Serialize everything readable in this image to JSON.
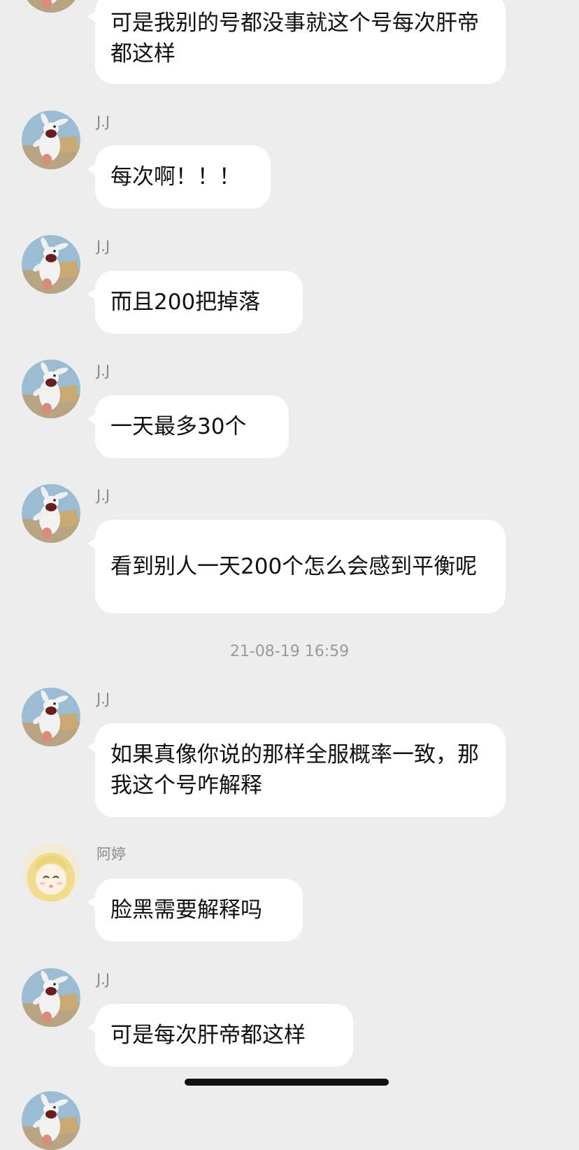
{
  "chat": {
    "timestamp": "21-08-19 16:59",
    "messages": [
      {
        "sender": "",
        "text": "可是我别的号都没事就这个号每次肝帝都这样",
        "avatar": "rabbit-avatar"
      },
      {
        "sender": "J.J",
        "text": "每次啊！！！",
        "avatar": "rabbit-avatar"
      },
      {
        "sender": "J.J",
        "text": "而且200把掉落",
        "avatar": "rabbit-avatar"
      },
      {
        "sender": "J.J",
        "text": "一天最多30个",
        "avatar": "rabbit-avatar"
      },
      {
        "sender": "J.J",
        "text": "看到别人一天200个怎么会感到平衡呢",
        "avatar": "rabbit-avatar"
      },
      {
        "sender": "J.J",
        "text": "如果真像你说的那样全服概率一致，那我这个号咋解释",
        "avatar": "rabbit-avatar"
      },
      {
        "sender": "阿婷",
        "text": "脸黑需要解释吗",
        "avatar": "anime-girl-avatar"
      },
      {
        "sender": "J.J",
        "text": "可是每次肝帝都这样",
        "avatar": "rabbit-avatar"
      }
    ]
  },
  "colors": {
    "background": "#ededed",
    "bubble": "#ffffff",
    "sender_text": "#8a8a8a",
    "message_text": "#111111",
    "timestamp_text": "#9a9a9a"
  }
}
